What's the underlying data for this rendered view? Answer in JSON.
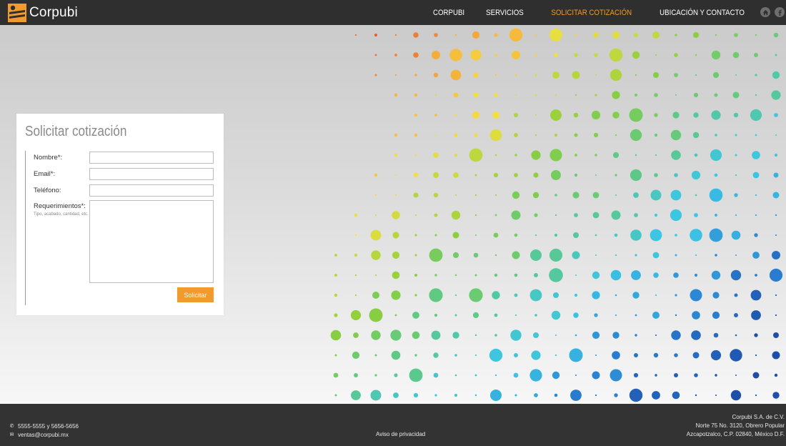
{
  "brand": {
    "name": "Corpubi",
    "accent": "#f39a2c",
    "logo_icon": "corpubi-logo-icon"
  },
  "nav": {
    "items": [
      {
        "label": "CORPUBI",
        "active": false
      },
      {
        "label": "SERVICIOS",
        "active": false
      },
      {
        "label": "SOLICITAR COTIZACIÓN",
        "active": true
      },
      {
        "label": "UBICACIÓN Y CONTACTO",
        "active": false
      }
    ],
    "social": [
      "home-icon",
      "facebook-icon"
    ]
  },
  "form": {
    "title": "Solicitar cotización",
    "fields": {
      "nombre": {
        "label": "Nombre*:",
        "value": ""
      },
      "email": {
        "label": "Email*:",
        "value": ""
      },
      "telefono": {
        "label": "Teléfono:",
        "value": ""
      },
      "requerimientos": {
        "label": "Requerimientos*:",
        "hint": "Tipo, acabado, cantidad, etc.",
        "value": ""
      }
    },
    "submit_label": "Solicitar"
  },
  "footer": {
    "phone": "5555-5555 y 5656-5656",
    "email": "ventas@corpubi.mx",
    "privacy_link": "Aviso de privacidad",
    "company": "Corpubi S.A. de C.V.",
    "address_line1": "Norte 75 No. 3120, Obrero Popular",
    "address_line2": "Azcapotzalco, C.P. 02840, México D.F."
  },
  "decoration": {
    "pattern": "halftone-dots",
    "palette": [
      "#e8432b",
      "#f4a33a",
      "#f6e040",
      "#8ccf3c",
      "#5cc98a",
      "#3bc6e6",
      "#2a7fd1",
      "#1d4fa8"
    ]
  }
}
